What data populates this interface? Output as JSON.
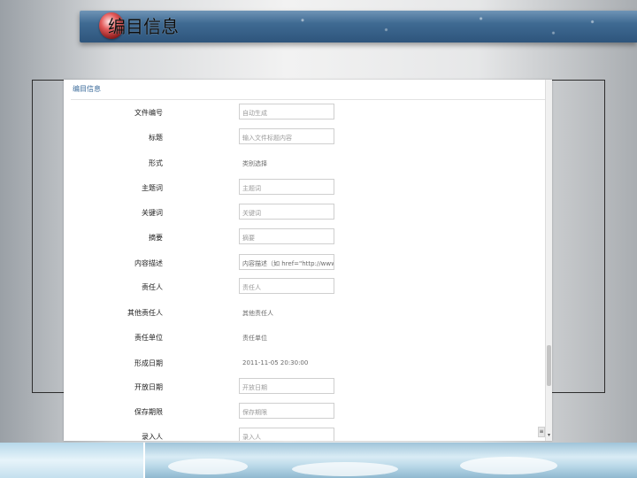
{
  "slide": {
    "title": "编目信息"
  },
  "panel": {
    "header_title": "编目信息"
  },
  "form": {
    "rows": [
      {
        "label": "文件编号",
        "value": "自动生成",
        "kind": "input"
      },
      {
        "label": "标题",
        "value": "输入文件标题内容",
        "kind": "input"
      },
      {
        "label": "形式",
        "value": "类别选择",
        "kind": "plain"
      },
      {
        "label": "主题词",
        "value": "主题词",
        "kind": "input"
      },
      {
        "label": "关键词",
        "value": "关键词",
        "kind": "input"
      },
      {
        "label": "摘要",
        "value": "摘要",
        "kind": "input"
      },
      {
        "label": "内容描述",
        "value": "内容描述（如 href=\"http://www.client.com/collect\"）",
        "kind": "input"
      },
      {
        "label": "责任人",
        "value": "责任人",
        "kind": "input"
      },
      {
        "label": "其他责任人",
        "value": "其他责任人",
        "kind": "plain"
      },
      {
        "label": "责任单位",
        "value": "责任单位",
        "kind": "plain"
      },
      {
        "label": "形成日期",
        "value": "2011-11-05 20:30:00",
        "kind": "plain"
      },
      {
        "label": "开放日期",
        "value": "开放日期",
        "kind": "input"
      },
      {
        "label": "保存期限",
        "value": "保存期限",
        "kind": "input"
      },
      {
        "label": "录入人",
        "value": "录入人",
        "kind": "input"
      }
    ]
  },
  "scrollbar": {
    "down_arrow": "▾",
    "corner_glyph": "≡"
  },
  "colors": {
    "banner": "#3f6a92",
    "panel_title": "#3a6a9a",
    "field_border": "#cfcfcf"
  }
}
